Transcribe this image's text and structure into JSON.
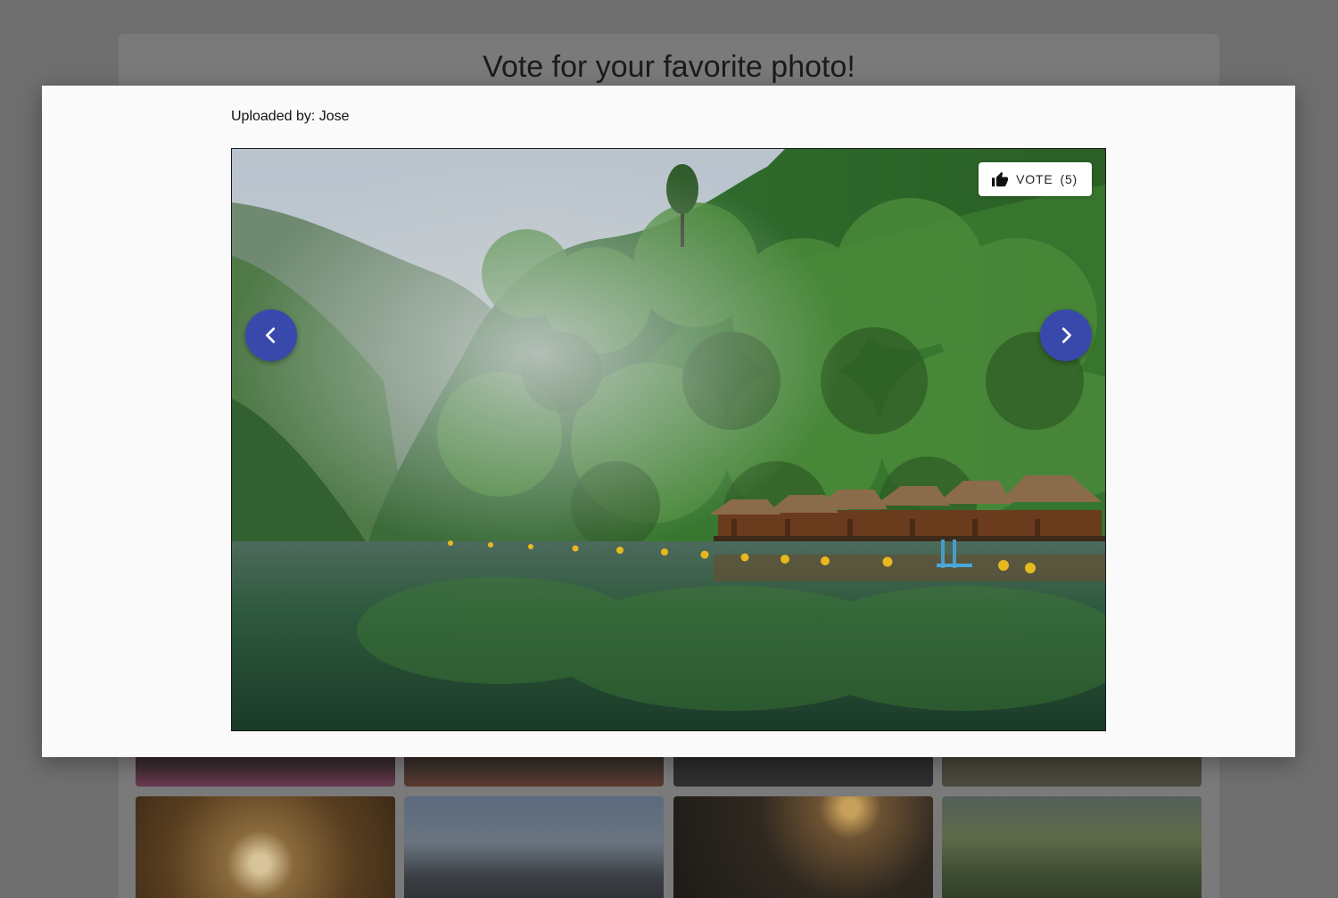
{
  "page": {
    "title": "Vote for your favorite photo!"
  },
  "modal": {
    "uploader": "Uploaded by: Jose",
    "vote": {
      "label": "VOTE",
      "count": "(5)"
    },
    "prev_icon": "chevron-left-icon",
    "next_icon": "chevron-right-icon",
    "vote_icon": "thumbs-up-icon"
  },
  "colors": {
    "nav_button": "#3949ab",
    "modal_bg": "#fafafa",
    "overlay": "#6f6f6f"
  }
}
